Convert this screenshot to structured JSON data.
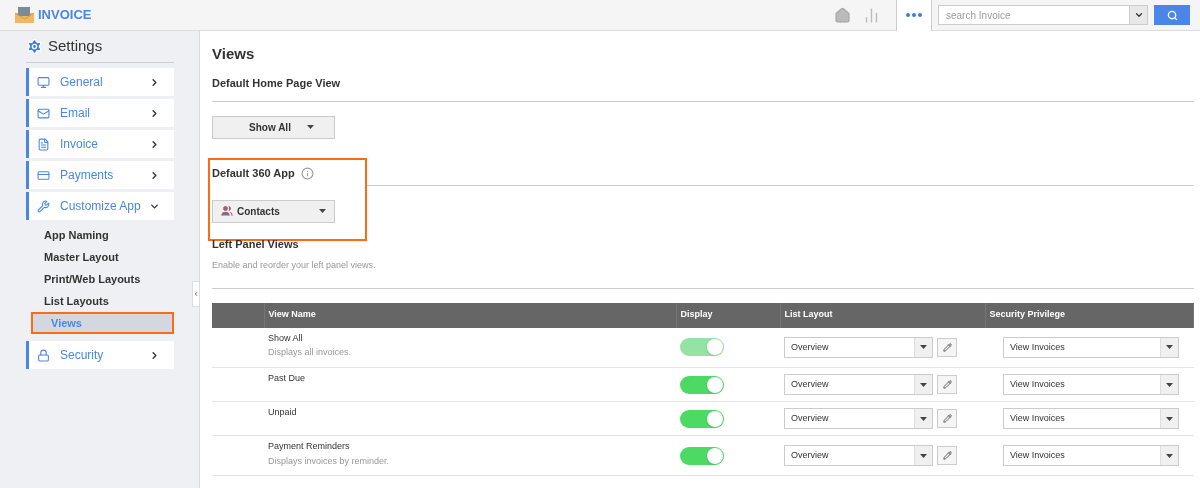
{
  "app": {
    "title": "INVOICE"
  },
  "toolbar": {
    "search_placeholder": "search Invoice"
  },
  "sidebar": {
    "title": "Settings",
    "items": [
      {
        "label": "General",
        "expanded": false
      },
      {
        "label": "Email",
        "expanded": false
      },
      {
        "label": "Invoice",
        "expanded": false
      },
      {
        "label": "Payments",
        "expanded": false
      },
      {
        "label": "Customize App",
        "expanded": true,
        "children": [
          {
            "label": "App Naming",
            "selected": false
          },
          {
            "label": "Master Layout",
            "selected": false
          },
          {
            "label": "Print/Web Layouts",
            "selected": false
          },
          {
            "label": "List Layouts",
            "selected": false
          },
          {
            "label": "Views",
            "selected": true
          }
        ]
      },
      {
        "label": "Security",
        "expanded": false
      }
    ]
  },
  "main": {
    "title": "Views",
    "home_view": {
      "heading": "Default Home Page View",
      "value": "Show All"
    },
    "app_360": {
      "heading": "Default 360 App",
      "value": "Contacts",
      "highlighted": true
    },
    "left_panel": {
      "heading": "Left Panel Views",
      "description": "Enable and reorder your left panel views.",
      "columns": [
        "View Name",
        "Display",
        "List Layout",
        "Security Privilege"
      ],
      "rows": [
        {
          "name": "Show All",
          "description": "Displays all invoices.",
          "on": true,
          "disabled": true,
          "layout": "Overview",
          "privilege": "View Invoices"
        },
        {
          "name": "Past Due",
          "on": true,
          "disabled": false,
          "layout": "Overview",
          "privilege": "View Invoices"
        },
        {
          "name": "Unpaid",
          "on": true,
          "disabled": false,
          "layout": "Overview",
          "privilege": "View Invoices"
        },
        {
          "name": "Payment Reminders",
          "description": "Displays invoices by reminder.",
          "on": true,
          "disabled": false,
          "layout": "Overview",
          "privilege": "View Invoices"
        }
      ]
    }
  }
}
